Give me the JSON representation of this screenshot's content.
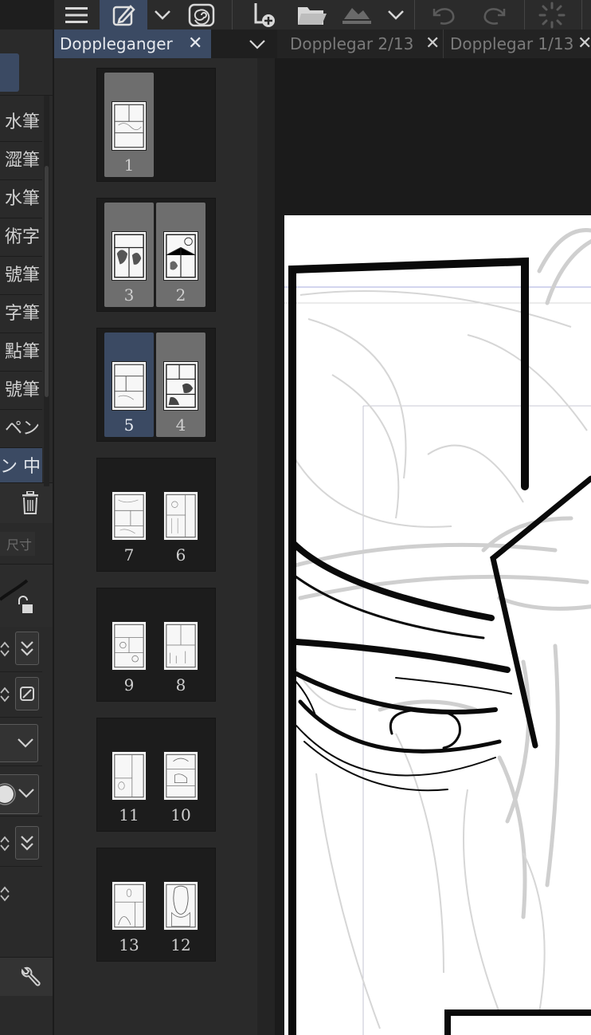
{
  "navigator": {
    "tab_label": "Doppleganger",
    "close_glyph": "✕",
    "menu_glyph": "⌄",
    "spreads": [
      {
        "pages": [
          {
            "num": "1",
            "state": "grey"
          }
        ]
      },
      {
        "pages": [
          {
            "num": "3",
            "state": "grey"
          },
          {
            "num": "2",
            "state": "grey"
          }
        ]
      },
      {
        "pages": [
          {
            "num": "5",
            "state": "selected"
          },
          {
            "num": "4",
            "state": "grey"
          }
        ]
      },
      {
        "pages": [
          {
            "num": "7",
            "state": "none"
          },
          {
            "num": "6",
            "state": "none"
          }
        ]
      },
      {
        "pages": [
          {
            "num": "9",
            "state": "none"
          },
          {
            "num": "8",
            "state": "none"
          }
        ]
      },
      {
        "pages": [
          {
            "num": "11",
            "state": "none"
          },
          {
            "num": "10",
            "state": "none"
          }
        ]
      },
      {
        "pages": [
          {
            "num": "13",
            "state": "none"
          },
          {
            "num": "12",
            "state": "none"
          }
        ]
      }
    ]
  },
  "documents": {
    "tabs": [
      {
        "label": "Dopplegar 2/13",
        "close": "✕"
      },
      {
        "label": "Dopplegar 1/13",
        "close": "✕"
      }
    ]
  },
  "brushes": {
    "items": [
      {
        "label": "水筆",
        "selected": false
      },
      {
        "label": "澀筆",
        "selected": false
      },
      {
        "label": "水筆",
        "selected": false
      },
      {
        "label": "術字",
        "selected": false
      },
      {
        "label": "號筆",
        "selected": false
      },
      {
        "label": "字筆",
        "selected": false
      },
      {
        "label": "點筆",
        "selected": false
      },
      {
        "label": "號筆",
        "selected": false
      },
      {
        "label": "ペン",
        "selected": false
      },
      {
        "label": "ン 中",
        "selected": true
      }
    ],
    "size_label": "尺寸"
  },
  "toolbar": {
    "icons": [
      "menu-icon",
      "pen-edit-icon",
      "chevron-down-icon",
      "spiral-icon",
      "new-page-icon",
      "folder-icon",
      "image-icon",
      "chevron-down-icon",
      "undo-icon",
      "redo-icon",
      "loading-icon"
    ]
  },
  "colors": {
    "accent": "#3b4a63",
    "panel": "#2a2a2a",
    "background": "#1b1b1b",
    "page_grey": "#6e6e6e"
  }
}
